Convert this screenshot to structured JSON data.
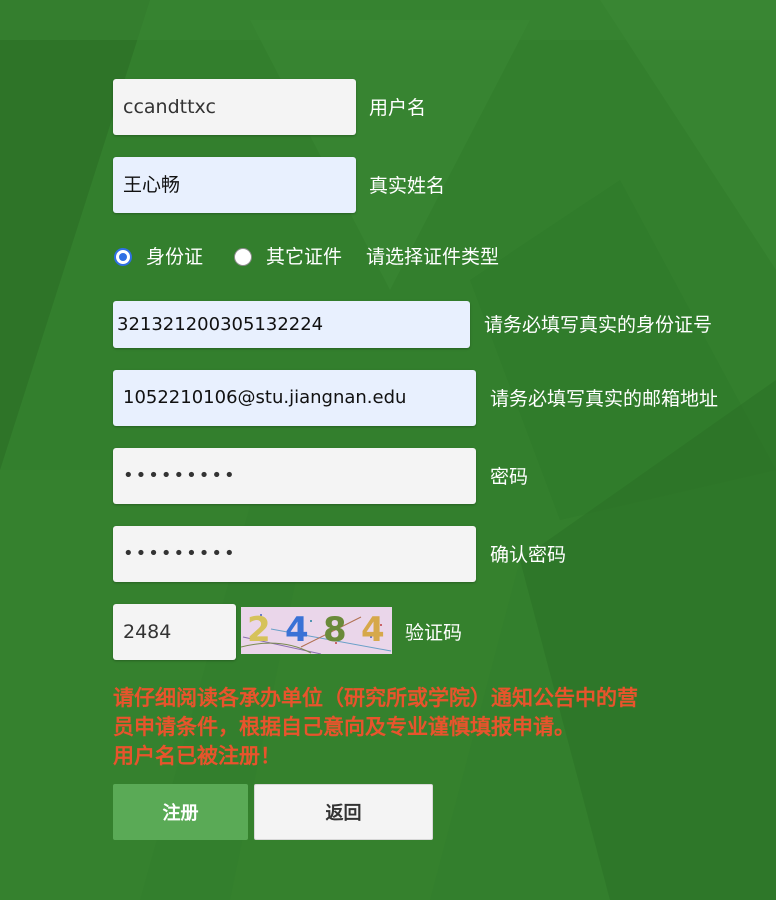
{
  "form": {
    "username": {
      "value": "ccandttxc",
      "label": "用户名"
    },
    "realname": {
      "value": "王心畅",
      "label": "真实姓名"
    },
    "id_type": {
      "options": [
        {
          "label": "身份证",
          "checked": true
        },
        {
          "label": "其它证件",
          "checked": false
        }
      ],
      "hint": "请选择证件类型"
    },
    "id_number": {
      "value": "321321200305132224",
      "label": "请务必填写真实的身份证号"
    },
    "email": {
      "value": "1052210106@stu.jiangnan.edu",
      "label": "请务必填写真实的邮箱地址"
    },
    "password": {
      "value": "•••••••••",
      "label": "密码"
    },
    "confirm_password": {
      "value": "•••••••••",
      "label": "确认密码"
    },
    "captcha": {
      "value": "2484",
      "label": "验证码",
      "image_text": "2484"
    }
  },
  "notice": {
    "line1": "请仔细阅读各承办单位（研究所或学院）通知公告中的营",
    "line2": "员申请条件，根据自己意向及专业谨慎填报申请。",
    "error": "用户名已被注册！"
  },
  "buttons": {
    "register": "注册",
    "back": "返回"
  },
  "colors": {
    "background": "#337f2d",
    "notice": "#e8542c",
    "register_button": "#5aaa56",
    "radio_accent": "#2f6fe4"
  }
}
